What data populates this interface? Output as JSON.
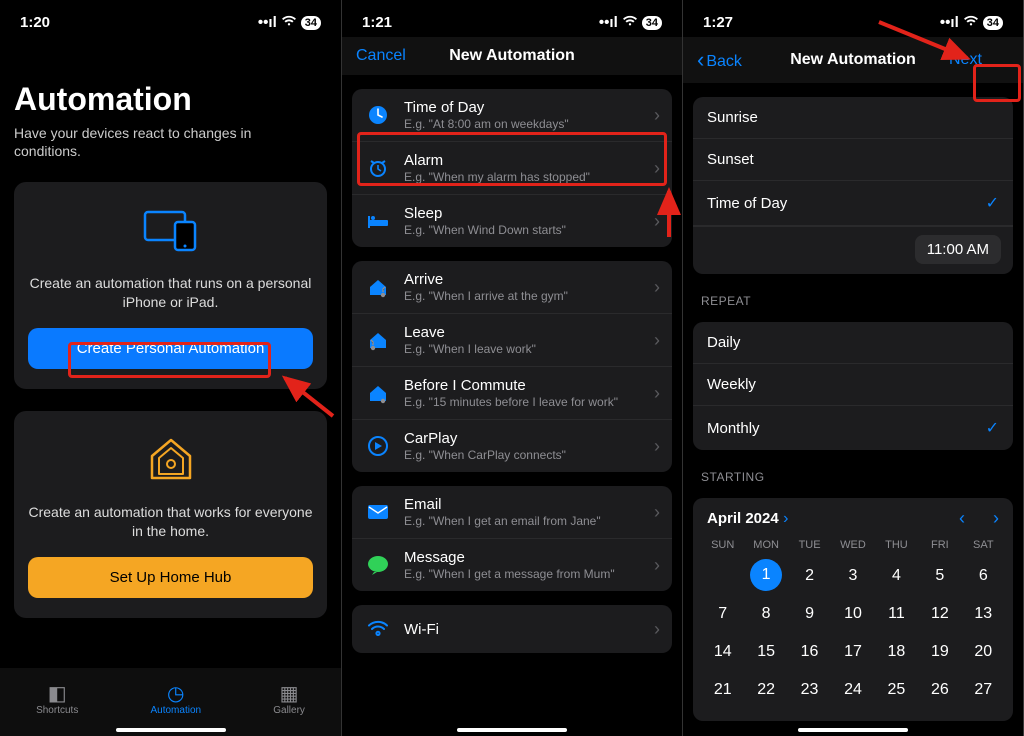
{
  "screens": [
    {
      "status_time": "1:20",
      "status_batt": "34",
      "title": "Automation",
      "subtitle": "Have your devices react to changes in conditions.",
      "card1": {
        "desc": "Create an automation that runs on a personal iPhone or iPad.",
        "button": "Create Personal Automation"
      },
      "card2": {
        "desc": "Create an automation that works for everyone in the home.",
        "button": "Set Up Home Hub"
      },
      "tabs": [
        "Shortcuts",
        "Automation",
        "Gallery"
      ]
    },
    {
      "status_time": "1:21",
      "status_batt": "34",
      "nav_left": "Cancel",
      "nav_title": "New Automation",
      "groups": [
        [
          {
            "title": "Time of Day",
            "sub": "E.g. \"At 8:00 am on weekdays\"",
            "icon": "clock"
          },
          {
            "title": "Alarm",
            "sub": "E.g. \"When my alarm has stopped\"",
            "icon": "alarm"
          },
          {
            "title": "Sleep",
            "sub": "E.g. \"When Wind Down starts\"",
            "icon": "bed"
          }
        ],
        [
          {
            "title": "Arrive",
            "sub": "E.g. \"When I arrive at the gym\"",
            "icon": "arrive"
          },
          {
            "title": "Leave",
            "sub": "E.g. \"When I leave work\"",
            "icon": "leave"
          },
          {
            "title": "Before I Commute",
            "sub": "E.g. \"15 minutes before I leave for work\"",
            "icon": "commute"
          },
          {
            "title": "CarPlay",
            "sub": "E.g. \"When CarPlay connects\"",
            "icon": "carplay"
          }
        ],
        [
          {
            "title": "Email",
            "sub": "E.g. \"When I get an email from Jane\"",
            "icon": "mail"
          },
          {
            "title": "Message",
            "sub": "E.g. \"When I get a message from Mum\"",
            "icon": "msg"
          }
        ],
        [
          {
            "title": "Wi-Fi",
            "sub": "",
            "icon": "wifi"
          }
        ]
      ]
    },
    {
      "status_time": "1:27",
      "status_batt": "34",
      "nav_left": "Back",
      "nav_title": "New Automation",
      "nav_right": "Next",
      "time_group": [
        "Sunrise",
        "Sunset",
        "Time of Day"
      ],
      "time_selected": "Time of Day",
      "time_value": "11:00 AM",
      "repeat_hdr": "REPEAT",
      "repeat_opts": [
        "Daily",
        "Weekly",
        "Monthly"
      ],
      "repeat_selected": "Monthly",
      "starting_hdr": "STARTING",
      "calendar": {
        "month": "April 2024",
        "dow": [
          "SUN",
          "MON",
          "TUE",
          "WED",
          "THU",
          "FRI",
          "SAT"
        ],
        "days": [
          " ",
          1,
          2,
          3,
          4,
          5,
          6,
          7,
          8,
          9,
          10,
          11,
          12,
          13,
          14,
          15,
          16,
          17,
          18,
          19,
          20,
          21,
          22,
          23,
          24,
          25,
          26,
          27
        ],
        "selected": 1
      }
    }
  ]
}
